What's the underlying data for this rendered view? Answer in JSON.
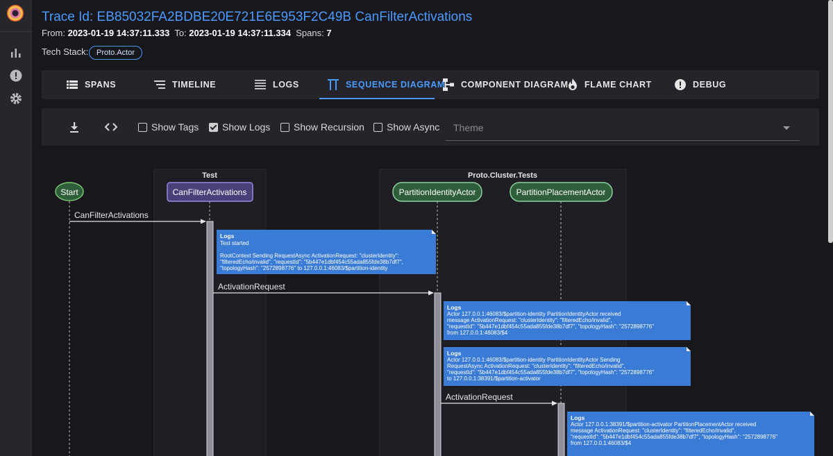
{
  "sidebar": {
    "items": [
      {
        "name": "charts-icon"
      },
      {
        "name": "alert-icon"
      },
      {
        "name": "settings-icon"
      }
    ]
  },
  "header": {
    "title": "Trace Id: EB85032FA2BDBE20E721E6E953F2C49B CanFilterActivations",
    "from_label": "From:",
    "from_value": "2023-01-19 14:37:11.333",
    "to_label": "To:",
    "to_value": "2023-01-19 14:37:11.334",
    "spans_label": "Spans:",
    "spans_value": "7",
    "tech_label": "Tech Stack:",
    "tech_chip": "Proto.Actor"
  },
  "tabs": [
    {
      "label": "SPANS"
    },
    {
      "label": "TIMELINE"
    },
    {
      "label": "LOGS"
    },
    {
      "label": "SEQUENCE DIAGRAM",
      "active": true
    },
    {
      "label": "COMPONENT DIAGRAM"
    },
    {
      "label": "FLAME CHART"
    },
    {
      "label": "DEBUG"
    }
  ],
  "toolbar": {
    "checkboxes": [
      {
        "label": "Show Tags",
        "checked": false
      },
      {
        "label": "Show Logs",
        "checked": true
      },
      {
        "label": "Show Recursion",
        "checked": false
      },
      {
        "label": "Show Async",
        "checked": false
      }
    ],
    "theme_placeholder": "Theme"
  },
  "diagram": {
    "groups": [
      {
        "label": "Test"
      },
      {
        "label": "Proto.Cluster.Tests"
      }
    ],
    "participants": [
      {
        "label": "Start"
      },
      {
        "label": "CanFilterActivations"
      },
      {
        "label": "PartitionIdentityActor"
      },
      {
        "label": "PartitionPlacementActor"
      }
    ],
    "messages": [
      {
        "label": "CanFilterActivations"
      },
      {
        "label": "ActivationRequest"
      },
      {
        "label": "ActivationRequest"
      }
    ],
    "notes": [
      {
        "title": "Logs",
        "lines": [
          "Test started",
          "",
          "RootContext Sending RequestAsync ActivationRequest: \"clusterIdentity\":",
          "\"filteredEcho/invalid\", \"requestId\": \"5b447e1dbf454c55ada855fde38b7df7\",",
          "\"topologyHash\": \"2572898776\" to 127.0.0.1:46083/$partition-identity"
        ]
      },
      {
        "title": "Logs",
        "lines": [
          "Actor 127.0.0.1:46083/$partition-identity PartitionIdentityActor received",
          "message ActivationRequest: \"clusterIdentity\": \"filteredEcho/invalid\",",
          "\"requestId\": \"5b447e1dbf454c55ada855fde38b7df7\", \"topologyHash\": \"2572898776\"",
          "from 127.0.0.1:46083/$4"
        ]
      },
      {
        "title": "Logs",
        "lines": [
          "Actor 127.0.0.1:46083/$partition-identity PartitionIdentityActor Sending",
          "RequestAsync ActivationRequest: \"clusterIdentity\": \"filteredEcho/invalid\",",
          "\"requestId\": \"5b447e1dbf454c55ada855fde38b7df7\", \"topologyHash\": \"2572898776\"",
          "to 127.0.0.1:38391/$partition-activator"
        ]
      },
      {
        "title": "Logs",
        "lines": [
          "Actor 127.0.0.1:38391/$partition-activator PartitionPlacementActor received",
          "message ActivationRequest: \"clusterIdentity\": \"filteredEcho/invalid\",",
          "\"requestId\": \"5b447e1dbf454c55ada855fde38b7df7\", \"topologyHash\": \"2572898776\"",
          "from 127.0.0.1:46083/$4"
        ]
      }
    ]
  },
  "colors": {
    "accent": "#4b9bff",
    "note_bg": "#3a7bd5",
    "actor_green": "#2f5e3a",
    "actor_purple": "#4b3f7a"
  }
}
